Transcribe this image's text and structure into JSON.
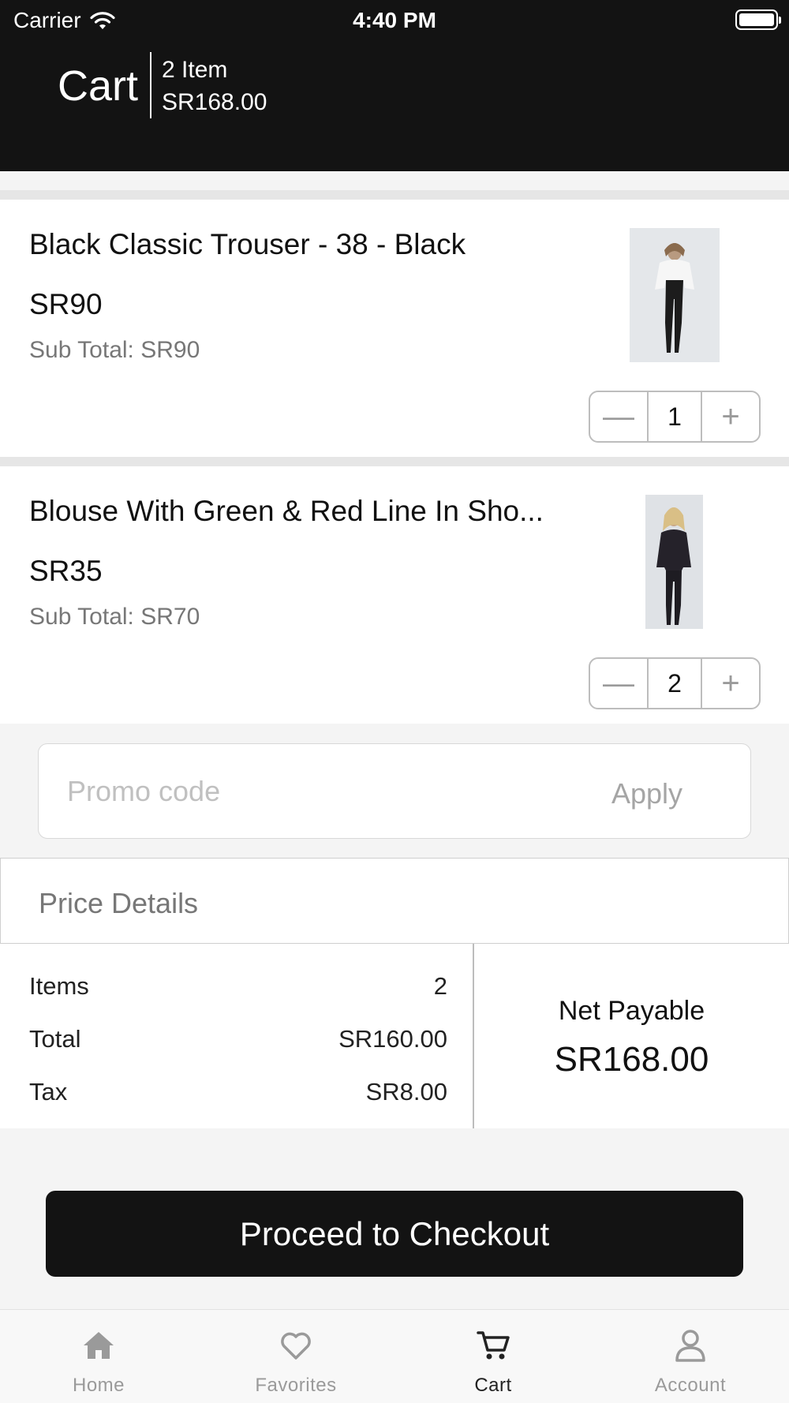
{
  "status_bar": {
    "carrier": "Carrier",
    "time": "4:40 PM"
  },
  "header": {
    "title": "Cart",
    "item_count": "2 Item",
    "total": "SR168.00"
  },
  "items": [
    {
      "name": "Black Classic Trouser - 38 - Black",
      "price": "SR90",
      "subtotal": "Sub Total: SR90",
      "quantity": "1"
    },
    {
      "name": "Blouse With Green & Red Line In Sho...",
      "price": "SR35",
      "subtotal": "Sub Total: SR70",
      "quantity": "2"
    }
  ],
  "stepper": {
    "minus": "—",
    "plus": "+"
  },
  "promo": {
    "placeholder": "Promo code",
    "apply_label": "Apply"
  },
  "price_details": {
    "title": "Price Details",
    "items_label": "Items",
    "items_value": "2",
    "total_label": "Total",
    "total_value": "SR160.00",
    "tax_label": "Tax",
    "tax_value": "SR8.00",
    "net_label": "Net Payable",
    "net_value": "SR168.00"
  },
  "checkout_label": "Proceed to Checkout",
  "tabs": [
    {
      "label": "Home",
      "icon": "home-icon"
    },
    {
      "label": "Favorites",
      "icon": "heart-icon"
    },
    {
      "label": "Cart",
      "icon": "cart-icon",
      "active": true
    },
    {
      "label": "Account",
      "icon": "person-icon"
    }
  ],
  "colors": {
    "header_bg": "#131313",
    "page_bg": "#f4f4f4",
    "muted_text": "#777777",
    "tab_inactive": "#9a9a9a",
    "tab_active": "#222222"
  }
}
